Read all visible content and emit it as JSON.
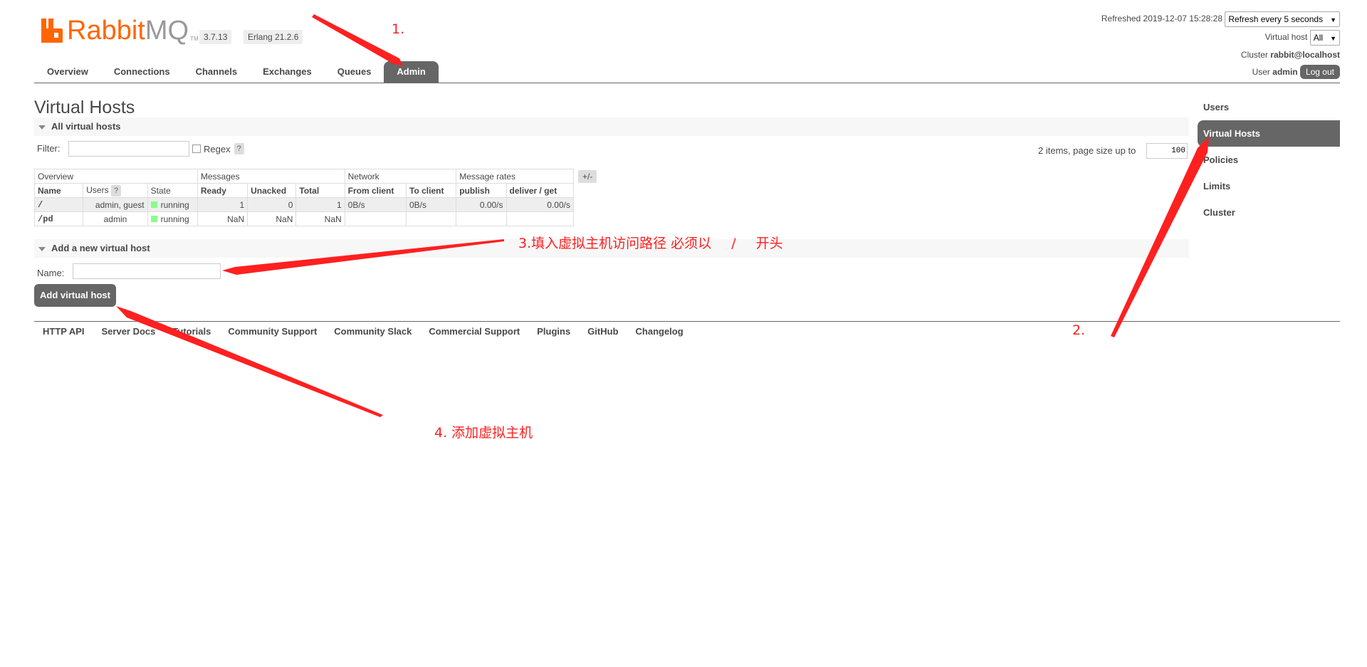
{
  "header": {
    "logo_word_rabbit": "Rabbit",
    "logo_word_mq": "MQ",
    "logo_tm": "TM",
    "version": "3.7.13",
    "erlang": "Erlang 21.2.6",
    "refreshed_label": "Refreshed 2019-12-07 15:28:28",
    "refresh_select": "Refresh every 5 seconds",
    "vhost_label": "Virtual host",
    "vhost_select": "All",
    "cluster_label": "Cluster",
    "cluster_value": "rabbit@localhost",
    "user_label": "User",
    "user_value": "admin",
    "logout": "Log out"
  },
  "tabs": [
    "Overview",
    "Connections",
    "Channels",
    "Exchanges",
    "Queues",
    "Admin"
  ],
  "active_tab": "Admin",
  "side_nav": [
    "Users",
    "Virtual Hosts",
    "Policies",
    "Limits",
    "Cluster"
  ],
  "page": {
    "title": "Virtual Hosts",
    "all_section": "All virtual hosts",
    "filter_label": "Filter:",
    "regex_label": "Regex",
    "help": "?",
    "pagination_label": "2 items, page size up to",
    "page_size": "100",
    "plus_minus": "+/-"
  },
  "table": {
    "groups": [
      "Overview",
      "Messages",
      "Network",
      "Message rates"
    ],
    "columns": [
      "Name",
      "Users",
      "State",
      "Ready",
      "Unacked",
      "Total",
      "From client",
      "To client",
      "publish",
      "deliver / get"
    ],
    "rows": [
      {
        "name": "/",
        "users": "admin, guest",
        "state": "running",
        "ready": "1",
        "unacked": "0",
        "total": "1",
        "from_client": "0B/s",
        "to_client": "0B/s",
        "publish": "0.00/s",
        "deliver": "0.00/s"
      },
      {
        "name": "/pd",
        "users": "admin",
        "state": "running",
        "ready": "NaN",
        "unacked": "NaN",
        "total": "NaN",
        "from_client": "",
        "to_client": "",
        "publish": "",
        "deliver": ""
      }
    ]
  },
  "add_section": {
    "title": "Add a new virtual host",
    "name_label": "Name:",
    "name_value": "",
    "button": "Add virtual host"
  },
  "footer": [
    "HTTP API",
    "Server Docs",
    "Tutorials",
    "Community Support",
    "Community Slack",
    "Commercial Support",
    "Plugins",
    "GitHub",
    "Changelog"
  ],
  "annotations": {
    "step1": "1.",
    "step2": "2.",
    "step3_text": "3.填入虚拟主机访问路径 必须以",
    "step3_slash": "/",
    "step3_end": "开头",
    "step4": "4. 添加虚拟主机"
  },
  "colors": {
    "brand": "#ff6600",
    "annotation": "#ff2020",
    "tab_active": "#666666"
  }
}
